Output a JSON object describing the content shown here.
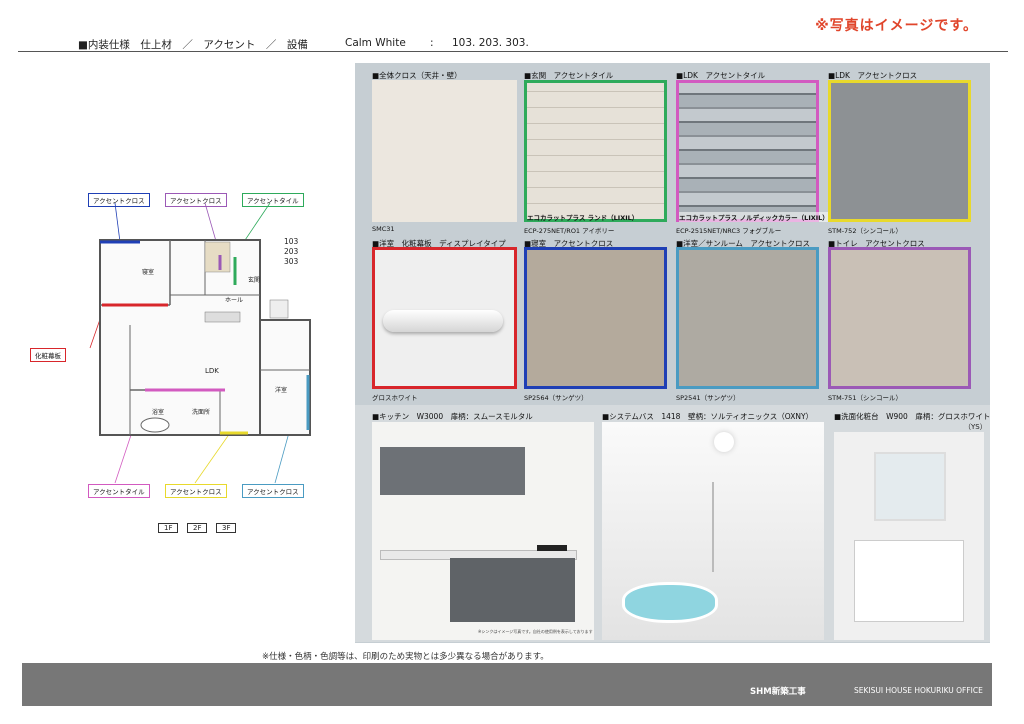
{
  "header": {
    "title": "■内装仕様　仕上材　／　アクセント　／　設備",
    "color_name": "Calm  White",
    "separator": ":",
    "rooms": "103. 203. 303.",
    "notice": "※写真はイメージです。"
  },
  "floorplan": {
    "unit_numbers": [
      "103",
      "203",
      "303"
    ],
    "room_labels": {
      "bedroom1": "寝室",
      "hall": "ホール",
      "entrance": "玄関",
      "ldk": "LDK",
      "western": "洋室",
      "bath": "浴室",
      "wash": "洗面所"
    },
    "callouts_top": [
      "アクセントクロス",
      "アクセントクロス",
      "アクセントタイル"
    ],
    "callout_left": "化粧幕板",
    "callouts_bottom": [
      "アクセントタイル",
      "アクセントクロス",
      "アクセントクロス"
    ],
    "floor_buttons": [
      "1F",
      "2F",
      "3F"
    ],
    "accent_colors": {
      "blue": "#1f3fb5",
      "purple": "#9b59b6",
      "green": "#2eaa5b",
      "red": "#d8262b",
      "magenta": "#d25ac0",
      "yellow": "#e8d92c",
      "teal": "#4a9bc2"
    }
  },
  "materials": [
    {
      "caption": "■全体クロス（天井・壁）",
      "code": "SMC31",
      "label": "",
      "border": "none",
      "fill": "#ece7df"
    },
    {
      "caption": "■玄関　アクセントタイル",
      "code": "ECP-275NET/RO1 アイボリー",
      "label": "エコカラットプラス ランド（LIXIL）",
      "border": "#2eaa5b",
      "fill": "#e6e1d8"
    },
    {
      "caption": "■LDK　アクセントタイル",
      "code": "ECP-2515NET/NRC3 フォグブルー",
      "label": "エコカラットプラス ノルディックカラー（LIXIL）",
      "border": "#d25ac0",
      "fill": "#a9b1b7"
    },
    {
      "caption": "■LDK　アクセントクロス",
      "code": "STM-752（シンコール）",
      "label": "",
      "border": "#e8d92c",
      "fill": "#8d9194"
    },
    {
      "caption": "■洋室　化粧幕板　ディスプレイタイプ",
      "code": "グロスホワイト",
      "label": "",
      "border": "#d8262b",
      "fill": "#eeeeee"
    },
    {
      "caption": "■寝室　アクセントクロス",
      "code": "SP2564（サンゲツ）",
      "label": "",
      "border": "#1f3fb5",
      "fill": "#b4aa9c"
    },
    {
      "caption": "■洋室／サンルーム　アクセントクロス",
      "code": "SP2541（サンゲツ）",
      "label": "",
      "border": "#4a9bc2",
      "fill": "#aeaaa2"
    },
    {
      "caption": "■トイレ　アクセントクロス",
      "code": "STM-751（シンコール）",
      "label": "",
      "border": "#9b59b6",
      "fill": "#c9c0b6"
    }
  ],
  "equipment": [
    {
      "caption": "■キッチン　W3000　扉柄：スムースモルタル",
      "sub": "※シンクはイメージ写真です。自社の使用例を表示しております"
    },
    {
      "caption": "■システムバス　1418　壁柄：ソルティオニックス（OXNY）",
      "sub": ""
    },
    {
      "caption": "■洗面化粧台　W900　扉柄：グロスホワイト",
      "sub": "（YS）"
    }
  ],
  "note": "※仕様・色柄・色調等は、印刷のため実物とは多少異なる場合があります。",
  "footer": {
    "left": "SHM新築工事",
    "right": "SEKISUI HOUSE HOKURIKU OFFICE"
  }
}
